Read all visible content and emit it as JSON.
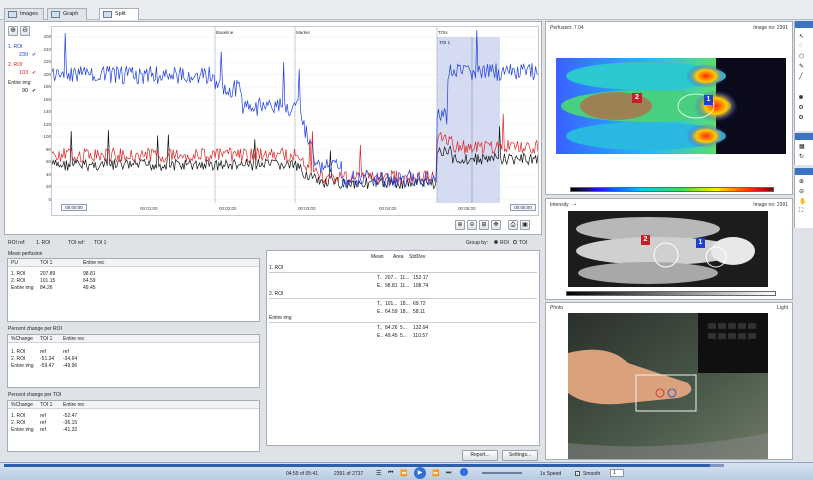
{
  "tabs": [
    {
      "label": "Images"
    },
    {
      "label": "Graph"
    },
    {
      "label": "Split"
    }
  ],
  "roi_list": {
    "roi1_label": "1. ROI",
    "roi1_value": "230",
    "roi2_label": "2. ROI",
    "roi2_value": "103",
    "entire_label": "Entire img",
    "entire_value": "90"
  },
  "graph": {
    "y_ticks": [
      "200",
      "240",
      "220",
      "200",
      "180",
      "160",
      "140",
      "120",
      "100",
      "80",
      "60",
      "40",
      "20",
      "0"
    ],
    "markers": [
      "Baseline",
      "Marker",
      "TOIs"
    ],
    "toi_label": "TOI 1",
    "x_start": "00:00:00",
    "x_end": "00:05:00",
    "x_ticks": [
      "00:01:00",
      "00:02:00",
      "00:03:00",
      "00:04:00",
      "00:05:00"
    ],
    "colors": {
      "roi1": "#1f3fe0",
      "roi2": "#e02424",
      "entire": "#111111",
      "toi_fill": "#b9c4ea"
    }
  },
  "controls": {
    "roi_ref_label": "ROI ref:",
    "roi_ref_value": "1. ROI",
    "toi_ref_label": "TOI ref:",
    "toi_ref_value": "TOI 1",
    "group_by_label": "Group by:",
    "group_roi": "ROI",
    "group_toi": "TOI"
  },
  "mean_perfusion": {
    "title": "Mean perfusion",
    "headers": [
      "PU",
      "TOI 1",
      "Entire rec"
    ],
    "rows": [
      [
        "1. ROI",
        "207.89",
        "98.81"
      ],
      [
        "2. ROI",
        "101.15",
        "64.59"
      ],
      [
        "Entire img",
        "84.26",
        "49.45"
      ]
    ]
  },
  "pct_roi": {
    "title": "Percent change per ROI",
    "headers": [
      "%Change",
      "TOI 1",
      "Entire rec"
    ],
    "rows": [
      [
        "1. ROI",
        "ref",
        "ref"
      ],
      [
        "2. ROI",
        "-51.34",
        "-34.64"
      ],
      [
        "Entire img",
        "-59.47",
        "-49.96"
      ]
    ]
  },
  "pct_toi": {
    "title": "Percent change per TOI",
    "headers": [
      "%Change",
      "TOI 1",
      "Entire rec"
    ],
    "rows": [
      [
        "1. ROI",
        "ref",
        "-52.47"
      ],
      [
        "2. ROI",
        "ref",
        "-36.15"
      ],
      [
        "Entire img",
        "ref",
        "-41.32"
      ]
    ]
  },
  "stats": {
    "headers": [
      "Mean",
      "Area",
      "StdDev"
    ],
    "groups": [
      {
        "name": "1. ROI",
        "rows": [
          [
            "T..",
            "207...",
            "11...",
            "152.17"
          ],
          [
            "E..",
            "98.81",
            "11...",
            "108.74"
          ]
        ]
      },
      {
        "name": "2. ROI",
        "rows": [
          [
            "T..",
            "101...",
            "18...",
            "69.72"
          ],
          [
            "E..",
            "64.59",
            "18...",
            "58.11"
          ]
        ]
      },
      {
        "name": "Entire img",
        "rows": [
          [
            "T..",
            "84.26",
            "5...",
            "132.94"
          ],
          [
            "E..",
            "49.45",
            "5...",
            "110.57"
          ]
        ]
      }
    ]
  },
  "buttons": {
    "report": "Report...",
    "settings": "Settings..."
  },
  "perfusion_panel": {
    "title": "Perfusion: 7.04",
    "image_no": "Image no: 2391",
    "roi1": "1",
    "roi2": "2"
  },
  "intensity_panel": {
    "title": "Intensity",
    "arrow": "⇢",
    "image_no": "Image no: 2391",
    "roi1": "1",
    "roi2": "2"
  },
  "photo_panel": {
    "title": "Photo",
    "light": "Light"
  },
  "playback": {
    "time": "04:59 of 05:41",
    "frames": "2391 of 2737",
    "speed_label": "1x Speed",
    "smooth_label": "Smooth",
    "smooth_value": "1"
  }
}
